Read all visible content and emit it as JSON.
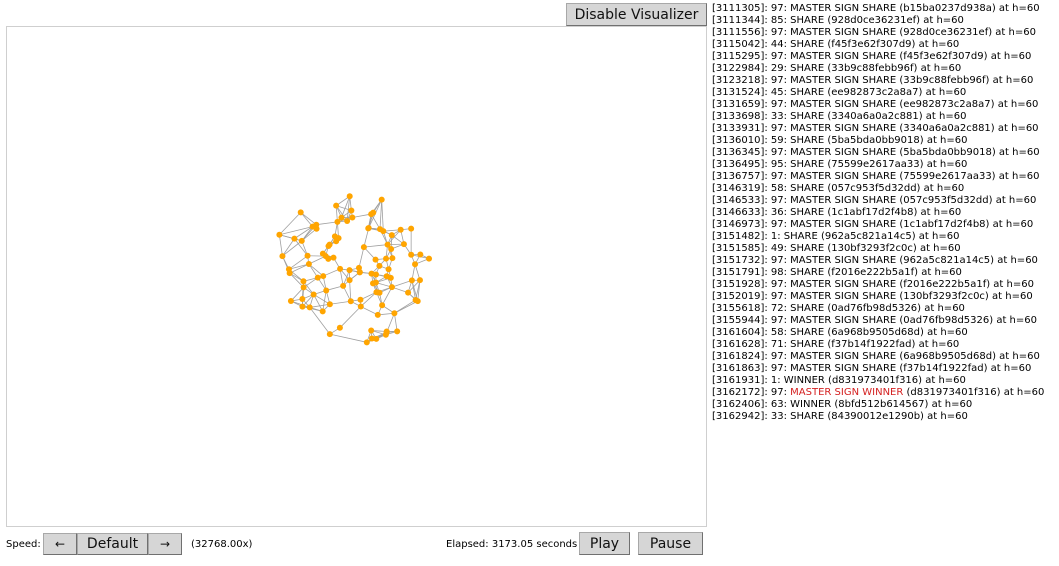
{
  "toolbar": {
    "toggle_label": "Disable Visualizer"
  },
  "log": [
    {
      "pre": "[3111305]: 97: MASTER SIGN SHARE (b15ba0237d938a) at h=60"
    },
    {
      "pre": "[3111344]: 85: SHARE (928d0ce36231ef) at h=60"
    },
    {
      "pre": "[3111556]: 97: MASTER SIGN SHARE (928d0ce36231ef) at h=60"
    },
    {
      "pre": "[3115042]: 44: SHARE (f45f3e62f307d9) at h=60"
    },
    {
      "pre": "[3115295]: 97: MASTER SIGN SHARE (f45f3e62f307d9) at h=60"
    },
    {
      "pre": "[3122984]: 29: SHARE (33b9c88febb96f) at h=60"
    },
    {
      "pre": "[3123218]: 97: MASTER SIGN SHARE (33b9c88febb96f) at h=60"
    },
    {
      "pre": "[3131524]: 45: SHARE (ee982873c2a8a7) at h=60"
    },
    {
      "pre": "[3131659]: 97: MASTER SIGN SHARE (ee982873c2a8a7) at h=60"
    },
    {
      "pre": "[3133698]: 33: SHARE (3340a6a0a2c881) at h=60"
    },
    {
      "pre": "[3133931]: 97: MASTER SIGN SHARE (3340a6a0a2c881) at h=60"
    },
    {
      "pre": "[3136010]: 59: SHARE (5ba5bda0bb9018) at h=60"
    },
    {
      "pre": "[3136345]: 97: MASTER SIGN SHARE (5ba5bda0bb9018) at h=60"
    },
    {
      "pre": "[3136495]: 95: SHARE (75599e2617aa33) at h=60"
    },
    {
      "pre": "[3136757]: 97: MASTER SIGN SHARE (75599e2617aa33) at h=60"
    },
    {
      "pre": "[3146319]: 58: SHARE (057c953f5d32dd) at h=60"
    },
    {
      "pre": "[3146533]: 97: MASTER SIGN SHARE (057c953f5d32dd) at h=60"
    },
    {
      "pre": "[3146633]: 36: SHARE (1c1abf17d2f4b8) at h=60"
    },
    {
      "pre": "[3146973]: 97: MASTER SIGN SHARE (1c1abf17d2f4b8) at h=60"
    },
    {
      "pre": "[3151482]: 1: SHARE (962a5c821a14c5) at h=60"
    },
    {
      "pre": "[3151585]: 49: SHARE (130bf3293f2c0c) at h=60"
    },
    {
      "pre": "[3151732]: 97: MASTER SIGN SHARE (962a5c821a14c5) at h=60"
    },
    {
      "pre": "[3151791]: 98: SHARE (f2016e222b5a1f) at h=60"
    },
    {
      "pre": "[3151928]: 97: MASTER SIGN SHARE (f2016e222b5a1f) at h=60"
    },
    {
      "pre": "[3152019]: 97: MASTER SIGN SHARE (130bf3293f2c0c) at h=60"
    },
    {
      "pre": "[3155618]: 72: SHARE (0ad76fb98d5326) at h=60"
    },
    {
      "pre": "[3155944]: 97: MASTER SIGN SHARE (0ad76fb98d5326) at h=60"
    },
    {
      "pre": "[3161604]: 58: SHARE (6a968b9505d68d) at h=60"
    },
    {
      "pre": "[3161628]: 71: SHARE (f37b14f1922fad) at h=60"
    },
    {
      "pre": "[3161824]: 97: MASTER SIGN SHARE (6a968b9505d68d) at h=60"
    },
    {
      "pre": "[3161863]: 97: MASTER SIGN SHARE (f37b14f1922fad) at h=60"
    },
    {
      "pre": "[3161931]: 1: WINNER (d831973401f316) at h=60"
    },
    {
      "pre": "[3162172]: 97: ",
      "hl": "MASTER SIGN WINNER",
      "post": " (d831973401f316) at h=60"
    },
    {
      "pre": "[3162406]: 63: WINNER (8bfd512b614567) at h=60"
    },
    {
      "pre": "[3162942]: 33: SHARE (84390012e1290b) at h=60"
    }
  ],
  "controls": {
    "speed_label": "Speed:",
    "left_arrow": "←",
    "default_label": "Default",
    "right_arrow": "→",
    "speed_value": "(32768.00x)",
    "elapsed": "Elapsed: 3173.05 seconds",
    "play_label": "Play",
    "pause_label": "Pause"
  },
  "colors": {
    "node": "#ffa500",
    "edge": "#a0a0a0",
    "highlight": "#d42020"
  },
  "icons": {
    "left_arrow": "arrow-left-icon",
    "right_arrow": "arrow-right-icon"
  }
}
